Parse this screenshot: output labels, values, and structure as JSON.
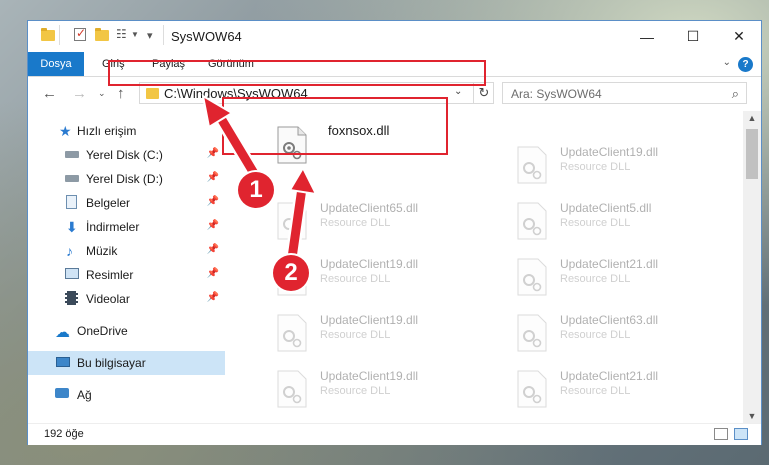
{
  "window": {
    "title": "SysWOW64",
    "minimize_glyph": "—",
    "maximize_glyph": "☐",
    "close_glyph": "✕"
  },
  "ribbon": {
    "tabs": [
      "Dosya",
      "Giriş",
      "Paylaş",
      "Görünüm"
    ],
    "help_label": "?"
  },
  "nav": {
    "address": "C:\\Windows\\SysWOW64",
    "search_placeholder": "Ara: SysWOW64"
  },
  "sidebar": {
    "items": [
      {
        "label": "Hızlı erişim",
        "icon": "star-icon",
        "pinned": false
      },
      {
        "label": "Yerel Disk (C:)",
        "icon": "drive-icon",
        "pinned": true
      },
      {
        "label": "Yerel Disk (D:)",
        "icon": "drive-icon",
        "pinned": true
      },
      {
        "label": "Belgeler",
        "icon": "documents-icon",
        "pinned": true
      },
      {
        "label": "İndirmeler",
        "icon": "downloads-icon",
        "pinned": true
      },
      {
        "label": "Müzik",
        "icon": "music-icon",
        "pinned": true
      },
      {
        "label": "Resimler",
        "icon": "pictures-icon",
        "pinned": true
      },
      {
        "label": "Videolar",
        "icon": "videos-icon",
        "pinned": true
      },
      {
        "label": "OneDrive",
        "icon": "cloud-icon",
        "pinned": false
      },
      {
        "label": "Bu bilgisayar",
        "icon": "computer-icon",
        "pinned": false,
        "selected": true
      },
      {
        "label": "Ağ",
        "icon": "network-icon",
        "pinned": false
      }
    ]
  },
  "files": {
    "highlighted": {
      "name": "foxnsox.dll"
    },
    "col1": [
      {
        "name": "UpdateClient65.dll",
        "type": "Resource DLL"
      },
      {
        "name": "UpdateClient19.dll",
        "type": "Resource DLL"
      },
      {
        "name": "UpdateClient19.dll",
        "type": "Resource DLL"
      },
      {
        "name": "UpdateClient19.dll",
        "type": "Resource DLL"
      }
    ],
    "col2": [
      {
        "name": "UpdateClient19.dll",
        "type": "Resource DLL"
      },
      {
        "name": "UpdateClient5.dll",
        "type": "Resource DLL"
      },
      {
        "name": "UpdateClient21.dll",
        "type": "Resource DLL"
      },
      {
        "name": "UpdateClient63.dll",
        "type": "Resource DLL"
      },
      {
        "name": "UpdateClient21.dll",
        "type": "Resource DLL"
      }
    ]
  },
  "status": {
    "count": "192 öğe"
  },
  "annotations": {
    "step1": "1",
    "step2": "2",
    "color": "#e0242f"
  }
}
